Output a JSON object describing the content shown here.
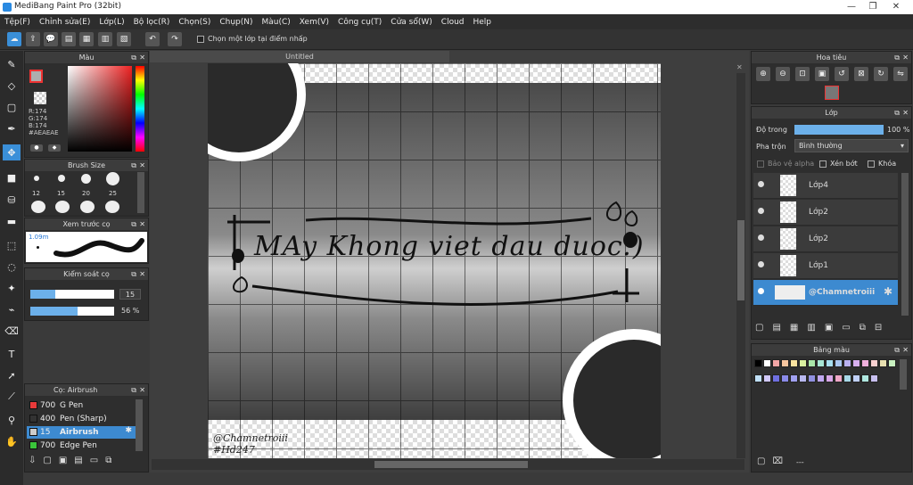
{
  "window": {
    "title": "MediBang Paint Pro (32bit)",
    "minimize": "—",
    "restore": "❐",
    "close": "✕"
  },
  "menu": [
    "Tệp(F)",
    "Chỉnh sửa(E)",
    "Lớp(L)",
    "Bộ lọc(R)",
    "Chọn(S)",
    "Chụp(N)",
    "Màu(C)",
    "Xem(V)",
    "Công cụ(T)",
    "Cửa sổ(W)",
    "Cloud",
    "Help"
  ],
  "toolbar": {
    "checkbox_label": "Chọn một lớp tại điểm nhấp"
  },
  "document": {
    "tab_title": "Untitled"
  },
  "color_panel": {
    "title": "Màu",
    "r": "R:174",
    "g": "G:174",
    "b": "B:174",
    "hex": "#AEAEAE",
    "main_color": "#aeaeae"
  },
  "brush_size_panel": {
    "title": "Brush Size",
    "sizes": [
      "12",
      "15",
      "20",
      "25"
    ]
  },
  "brush_preview_panel": {
    "title": "Xem trước cọ",
    "size_label": "1.09m"
  },
  "brush_control_panel": {
    "title": "Kiểm soát cọ",
    "size_value": "15",
    "opacity_value": "56 %",
    "size_fraction": 0.3,
    "opacity_fraction": 0.56
  },
  "brush_list_panel": {
    "title": "Cọ: Airbrush",
    "brushes": [
      {
        "size": "700",
        "name": "G Pen",
        "color": "#e83a3a"
      },
      {
        "size": "400",
        "name": "Pen (Sharp)",
        "color": "#333333"
      },
      {
        "size": "15",
        "name": "Airbrush",
        "color": "#cccccc"
      },
      {
        "size": "700",
        "name": "Edge Pen",
        "color": "#3ac43a"
      }
    ]
  },
  "navigator_panel": {
    "title": "Hoa tiêu"
  },
  "layer_panel": {
    "title": "Lớp",
    "opacity_label": "Độ trong",
    "opacity_value": "100 %",
    "blend_label": "Pha trộn",
    "blend_value": "Bình thường",
    "protect_alpha": "Bảo vệ alpha",
    "clipping": "Xén bớt",
    "lock": "Khóa",
    "layers": [
      "Lớp4",
      "Lớp2",
      "Lớp2",
      "Lớp1",
      "@Chamnetroiii"
    ]
  },
  "palette_panel": {
    "title": "Bảng màu",
    "footer": "---"
  },
  "artwork": {
    "text_main": "MAy Khong viet  dau duoc:)",
    "watermark1": "@Chamnetroiii",
    "watermark2": "#Hd247"
  }
}
